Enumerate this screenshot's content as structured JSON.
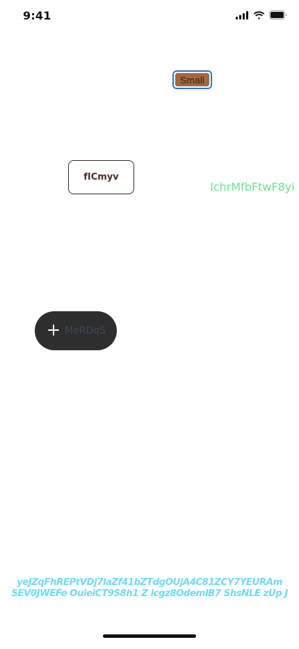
{
  "status_bar": {
    "time": "9:41"
  },
  "small_button": {
    "label": "Small",
    "fill_color": "#a0693f",
    "focus_ring_color": "#2f6fe0"
  },
  "outline_button": {
    "label": "fICmyv"
  },
  "green_text": {
    "text": "IchrMfbFtwF8yi",
    "color": "#6ee08f"
  },
  "pill_button": {
    "icon": "plus-icon",
    "label": "MeRDqS",
    "background": "#2e2e2e"
  },
  "cyan_text": {
    "line1": "yeJZqFhREPtVDj7laZf41bZTdgOUjA4C81ZCY7YEURAm",
    "line2": "SEV0JWEFe OuieiCT9S8h1 Z icgz8OdemlB7 ShsNLE zUp J",
    "color": "#72dbf2"
  }
}
